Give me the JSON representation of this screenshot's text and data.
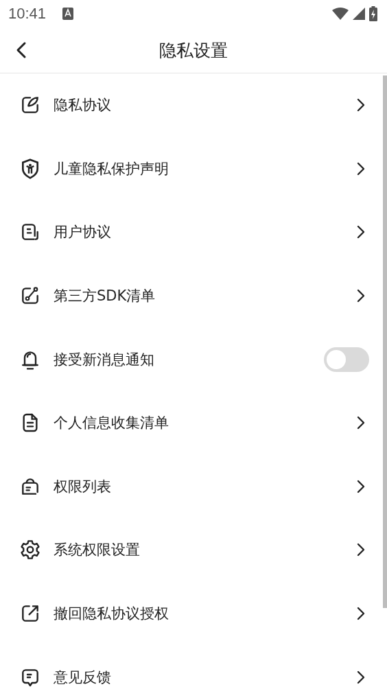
{
  "status_bar": {
    "time": "10:41"
  },
  "header": {
    "title": "隐私设置"
  },
  "items": [
    {
      "kind": "link",
      "label": "隐私协议"
    },
    {
      "kind": "link",
      "label": "儿童隐私保护声明"
    },
    {
      "kind": "link",
      "label": "用户协议"
    },
    {
      "kind": "link",
      "label": "第三方SDK清单"
    },
    {
      "kind": "toggle",
      "label": "接受新消息通知",
      "on": false
    },
    {
      "kind": "link",
      "label": "个人信息收集清单"
    },
    {
      "kind": "link",
      "label": "权限列表"
    },
    {
      "kind": "link",
      "label": "系统权限设置"
    },
    {
      "kind": "link",
      "label": "撤回隐私协议授权"
    },
    {
      "kind": "link",
      "label": "意见反馈"
    }
  ]
}
